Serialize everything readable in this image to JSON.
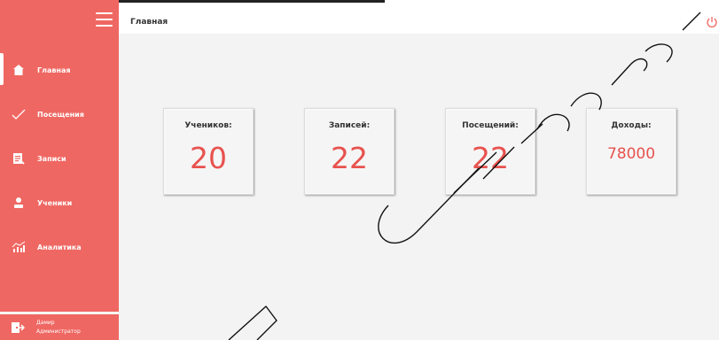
{
  "sidebar": {
    "items": [
      {
        "label": "Главная",
        "icon": "home-icon",
        "active": true
      },
      {
        "label": "Посещения",
        "icon": "checkmark-icon",
        "active": false
      },
      {
        "label": "Записи",
        "icon": "document-icon",
        "active": false
      },
      {
        "label": "Ученики",
        "icon": "user-icon",
        "active": false
      },
      {
        "label": "Аналитика",
        "icon": "analytics-icon",
        "active": false
      }
    ],
    "user": {
      "name": "Дамир",
      "role": "Администратор",
      "icon": "logout-icon"
    }
  },
  "header": {
    "title": "Главная",
    "power_icon": "power-icon"
  },
  "cards": [
    {
      "title": "Учеников:",
      "value": "20"
    },
    {
      "title": "Записей:",
      "value": "22"
    },
    {
      "title": "Посещений:",
      "value": "22"
    },
    {
      "title": "Доходы:",
      "value": "78000"
    }
  ],
  "colors": {
    "accent": "#ef6762",
    "value_red": "#e8524e",
    "background": "#f3f3f3"
  }
}
